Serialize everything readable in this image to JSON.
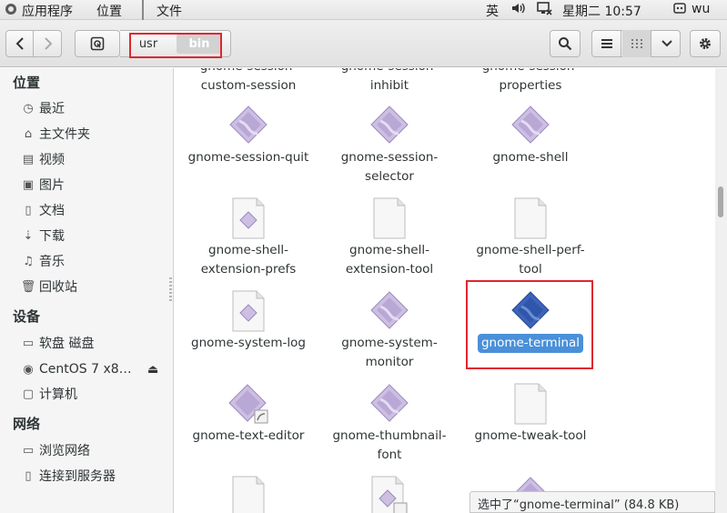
{
  "topbar": {
    "apps_menu": "应用程序",
    "places_menu": "位置",
    "window_menu": "文件",
    "input_method": "英",
    "clock": "星期二 10:57",
    "user": "wu"
  },
  "path": {
    "segments": [
      "usr",
      "bin"
    ]
  },
  "sidebar": {
    "places_heading": "位置",
    "places": [
      {
        "label": "最近",
        "icon": "clock-icon"
      },
      {
        "label": "主文件夹",
        "icon": "home-icon"
      },
      {
        "label": "视频",
        "icon": "video-icon"
      },
      {
        "label": "图片",
        "icon": "camera-icon"
      },
      {
        "label": "文档",
        "icon": "document-icon"
      },
      {
        "label": "下载",
        "icon": "download-icon"
      },
      {
        "label": "音乐",
        "icon": "music-icon"
      },
      {
        "label": "回收站",
        "icon": "trash-icon"
      }
    ],
    "devices_heading": "设备",
    "devices": [
      {
        "label": "软盘 磁盘",
        "icon": "floppy-icon"
      },
      {
        "label": "CentOS 7 x8…",
        "icon": "disc-icon"
      },
      {
        "label": "计算机",
        "icon": "computer-icon"
      }
    ],
    "network_heading": "网络",
    "network": [
      {
        "label": "浏览网络",
        "icon": "network-icon"
      },
      {
        "label": "连接到服务器",
        "icon": "server-icon"
      }
    ]
  },
  "files": {
    "row0": [
      {
        "line1": "gnome-session-",
        "line2": "custom-session"
      },
      {
        "line1": "gnome-session-",
        "line2": "inhibit"
      },
      {
        "line1": "gnome-session-",
        "line2": "properties"
      }
    ],
    "row1": [
      {
        "line1": "gnome-session-quit",
        "line2": ""
      },
      {
        "line1": "gnome-session-",
        "line2": "selector"
      },
      {
        "line1": "gnome-shell",
        "line2": ""
      }
    ],
    "row2": [
      {
        "line1": "gnome-shell-",
        "line2": "extension-prefs"
      },
      {
        "line1": "gnome-shell-",
        "line2": "extension-tool"
      },
      {
        "line1": "gnome-shell-perf-",
        "line2": "tool"
      }
    ],
    "row3": [
      {
        "line1": "gnome-system-log",
        "line2": ""
      },
      {
        "line1": "gnome-system-",
        "line2": "monitor"
      },
      {
        "line1": "gnome-terminal",
        "line2": ""
      }
    ],
    "row4": [
      {
        "line1": "gnome-text-editor",
        "line2": ""
      },
      {
        "line1": "gnome-thumbnail-",
        "line2": "font"
      },
      {
        "line1": "gnome-tweak-tool",
        "line2": ""
      }
    ]
  },
  "status": "选中了“gnome-terminal” (84.8 KB)",
  "colors": {
    "selection": "#4a90d9",
    "highlight_box": "#e0262e",
    "exec_icon": "#cbbbe0"
  }
}
